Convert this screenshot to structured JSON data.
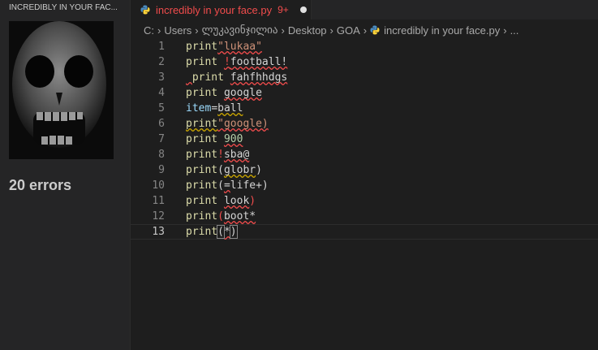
{
  "panel": {
    "title": "INCREDIBLY IN YOUR FAC...",
    "errors_label": "20 errors"
  },
  "tab": {
    "title": "incredibly in your face.py",
    "badge": "9+",
    "icon": "python-icon"
  },
  "breadcrumb": {
    "items": [
      "C:",
      "Users",
      "ლუკავინჯილია",
      "Desktop",
      "GOA",
      "incredibly in your face.py",
      "..."
    ]
  },
  "editor": {
    "current_line": 13,
    "lines": [
      {
        "n": "1",
        "text": "print\"lukaa\""
      },
      {
        "n": "2",
        "text": "print !football!"
      },
      {
        "n": "3",
        "text": " print fahfhhdgs"
      },
      {
        "n": "4",
        "text": "print google"
      },
      {
        "n": "5",
        "text": "item=ball"
      },
      {
        "n": "6",
        "text": "print\"google)"
      },
      {
        "n": "7",
        "text": "print 900"
      },
      {
        "n": "8",
        "text": "print!sba@"
      },
      {
        "n": "9",
        "text": "print(globr)"
      },
      {
        "n": "10",
        "text": "print(=life+)"
      },
      {
        "n": "11",
        "text": "print look)"
      },
      {
        "n": "12",
        "text": "print(boot*"
      },
      {
        "n": "13",
        "text": "print(*)"
      }
    ]
  },
  "colors": {
    "error": "#f14c4c",
    "warning": "#cca700",
    "background": "#1e1e1e"
  }
}
